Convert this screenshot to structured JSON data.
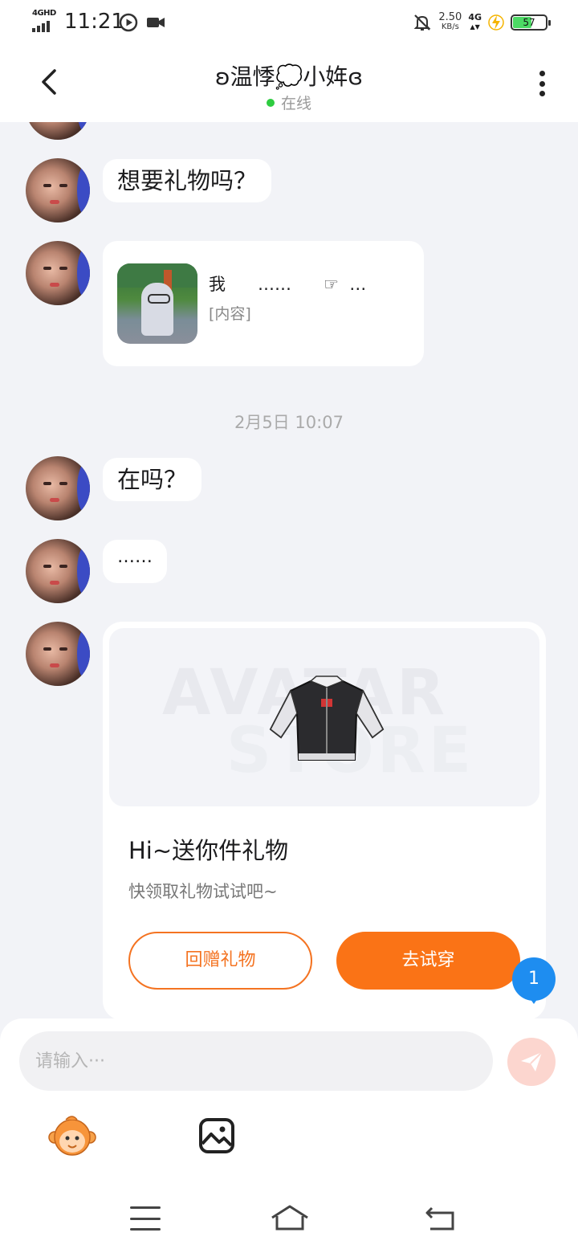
{
  "status_bar": {
    "network_label": "4GHD",
    "time": "11:21",
    "speed_value": "2.50",
    "speed_unit": "KB/s",
    "signal_label": "4G",
    "battery": "57"
  },
  "header": {
    "title": "ʚ温悸💭小姩ɞ",
    "status": "在线"
  },
  "messages": [
    {
      "type": "text",
      "text": "想要礼物吗？"
    },
    {
      "type": "share",
      "title": "我      ……      ☞  …",
      "subtitle": "[内容]"
    },
    {
      "type": "text",
      "text": "在吗？"
    },
    {
      "type": "text",
      "text": "……"
    }
  ],
  "timestamp": "2月5日 10:07",
  "gift_card": {
    "watermark_line1": "AVATAR",
    "watermark_line2": "STORE",
    "title": "Hi~送你件礼物",
    "subtitle": "快领取礼物试试吧~",
    "return_label": "回赠礼物",
    "try_label": "去试穿"
  },
  "unread_badge": "1",
  "input": {
    "placeholder": "请输入···",
    "value": ""
  },
  "icons": {
    "send": "paper-plane-icon",
    "emoji": "monkey-emoji-icon",
    "image": "image-icon"
  },
  "colors": {
    "accent": "#fa7316",
    "online": "#2ecc40",
    "badge": "#1e8df0"
  }
}
